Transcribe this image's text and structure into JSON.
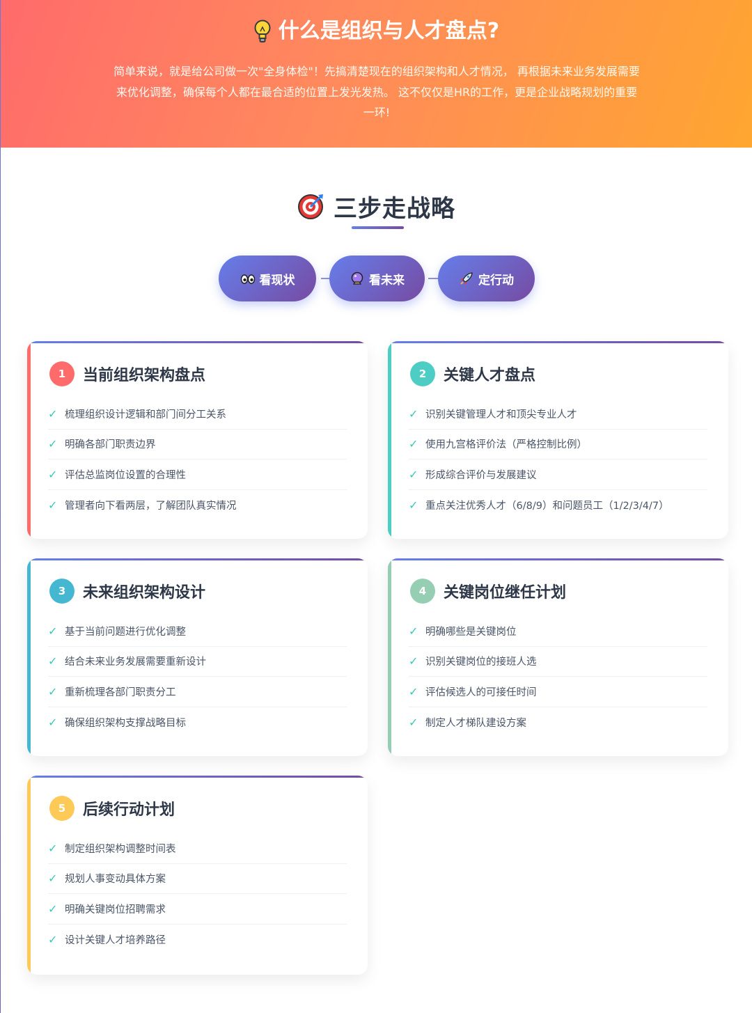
{
  "hero": {
    "title": "什么是组织与人才盘点?",
    "description": "简单来说，就是给公司做一次\"全身体检\"！先搞清楚现在的组织架构和人才情况， 再根据未来业务发展需要来优化调整，确保每个人都在最合适的位置上发光发热。 这不仅仅是HR的工作，更是企业战略规划的重要一环!"
  },
  "strategy": {
    "title": "三步走战略",
    "steps": [
      {
        "label": "看现状",
        "icon": "eyes-icon"
      },
      {
        "label": "看未来",
        "icon": "crystal-ball-icon"
      },
      {
        "label": "定行动",
        "icon": "rocket-icon"
      }
    ]
  },
  "cards": [
    {
      "number": "1",
      "title": "当前组织架构盘点",
      "color": "#ff6b6b",
      "items": [
        "梳理组织设计逻辑和部门间分工关系",
        "明确各部门职责边界",
        "评估总监岗位设置的合理性",
        "管理者向下看两层，了解团队真实情况"
      ]
    },
    {
      "number": "2",
      "title": "关键人才盘点",
      "color": "#4ecdc4",
      "items": [
        "识别关键管理人才和顶尖专业人才",
        "使用九宫格评价法（严格控制比例）",
        "形成综合评价与发展建议",
        "重点关注优秀人才（6/8/9）和问题员工（1/2/3/4/7）"
      ]
    },
    {
      "number": "3",
      "title": "未来组织架构设计",
      "color": "#45b7d1",
      "items": [
        "基于当前问题进行优化调整",
        "结合未来业务发展需要重新设计",
        "重新梳理各部门职责分工",
        "确保组织架构支撑战略目标"
      ]
    },
    {
      "number": "4",
      "title": "关键岗位继任计划",
      "color": "#96ceb4",
      "items": [
        "明确哪些是关键岗位",
        "识别关键岗位的接班人选",
        "评估候选人的可接任时间",
        "制定人才梯队建设方案"
      ]
    },
    {
      "number": "5",
      "title": "后续行动计划",
      "color": "#feca57",
      "items": [
        "制定组织架构调整时间表",
        "规划人事变动具体方案",
        "明确关键岗位招聘需求",
        "设计关键人才培养路径"
      ]
    }
  ]
}
